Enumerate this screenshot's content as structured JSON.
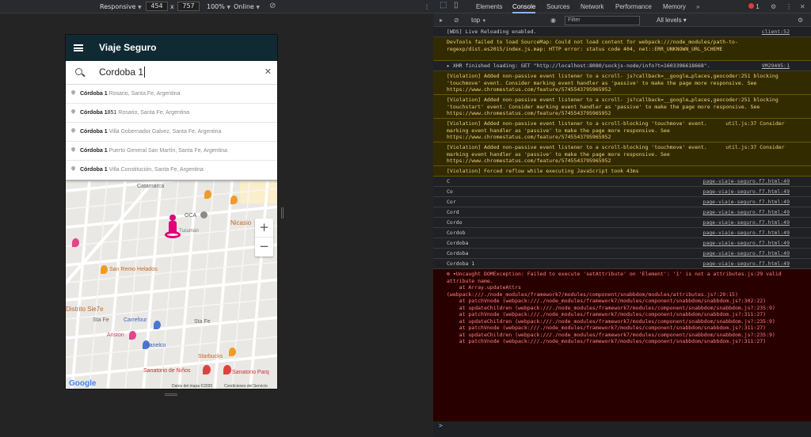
{
  "devbar": {
    "mode": "Responsive",
    "width": "454",
    "height": "757",
    "zoom": "100%",
    "network": "Online"
  },
  "app": {
    "title": "Viaje Seguro",
    "search_value": "Cordoba 1",
    "clear": "✕"
  },
  "suggestions": [
    {
      "bold": "Córdoba 1",
      "sec": " Rosario, Santa Fe, Argentina"
    },
    {
      "bold": "Córdoba 1",
      "mid": "851",
      "sec": " Rosario, Santa Fe, Argentina"
    },
    {
      "bold": "Córdoba 1",
      "sec": " Villa Gobernador Galvez, Santa Fe, Argentina"
    },
    {
      "bold": "Córdoba 1",
      "sec": " Puerto General San Martín, Santa Fe, Argentina"
    },
    {
      "bold": "Córdoba 1",
      "sec": " Villa Constitución, Santa Fe, Argentina"
    }
  ],
  "map": {
    "labels": [
      "Catamarca",
      "OCA",
      "Nicasio",
      "Tucumán",
      "San Remo Helados",
      "Distrito Sie7e",
      "Sta Fe",
      "Carrefour",
      "Sta Fe",
      "Ariston",
      "Banelco",
      "Starbucks",
      "Sanatorio de Niños",
      "Sanatorio Parq",
      "Google",
      "Datos del mapa ©2020",
      "Condiciones del Servicio"
    ],
    "zoom_in": "+",
    "zoom_out": "−"
  },
  "devtools": {
    "tabs": [
      "Elements",
      "Console",
      "Sources",
      "Network",
      "Performance",
      "Memory"
    ],
    "error_count": "1",
    "context": "top",
    "filter_placeholder": "Filter",
    "levels": "All levels ▾"
  },
  "console": [
    {
      "type": "log",
      "text": "[WDS] Live Reloading enabled.",
      "src": "client:52"
    },
    {
      "type": "warn",
      "text": "DevTools failed to load SourceMap: Could not load content for webpack:///node_modules/path-to-regexp/dist.es2015/index.js.map: HTTP error: status code 404, net::ERR_UNKNOWN_URL_SCHEME",
      "src": ""
    },
    {
      "type": "log",
      "text": "▸ XHR finished loading: GET \"http://localhost:8080/sockjs-node/info?t=1603396618668\".",
      "src": "VM29405:1"
    },
    {
      "type": "warn",
      "text": "[Violation] Added non-passive event listener to a scroll- js?callback=__google…places,geocoder:251 blocking 'touchmove' event. Consider marking event handler as 'passive' to make the page more responsive. See https://www.chromestatus.com/feature/5745543795965952",
      "src": ""
    },
    {
      "type": "warn",
      "text": "[Violation] Added non-passive event listener to a scroll- js?callback=__google…places,geocoder:251 blocking 'touchstart' event. Consider marking event handler as 'passive' to make the page more responsive. See https://www.chromestatus.com/feature/5745543795965952",
      "src": ""
    },
    {
      "type": "warn",
      "text": "[Violation] Added non-passive event listener to a scroll-blocking 'touchmove' event.      util.js:37 Consider marking event handler as 'passive' to make the page more responsive. See https://www.chromestatus.com/feature/5745543795965952",
      "src": ""
    },
    {
      "type": "warn",
      "text": "[Violation] Added non-passive event listener to a scroll-blocking 'touchmove' event.      util.js:37 Consider marking event handler as 'passive' to make the page more responsive. See https://www.chromestatus.com/feature/5745543795965952",
      "src": ""
    },
    {
      "type": "warn",
      "text": "[Violation] Forced reflow while executing JavaScript took 43ms",
      "src": ""
    },
    {
      "type": "log",
      "text": "C",
      "src": "page-viaje-seguro.f7.html:49"
    },
    {
      "type": "log",
      "text": "Co",
      "src": "page-viaje-seguro.f7.html:49"
    },
    {
      "type": "log",
      "text": "Cor",
      "src": "page-viaje-seguro.f7.html:49"
    },
    {
      "type": "log",
      "text": "Cord",
      "src": "page-viaje-seguro.f7.html:49"
    },
    {
      "type": "log",
      "text": "Cordo",
      "src": "page-viaje-seguro.f7.html:49"
    },
    {
      "type": "log",
      "text": "Cordob",
      "src": "page-viaje-seguro.f7.html:49"
    },
    {
      "type": "log",
      "text": "Cordoba",
      "src": "page-viaje-seguro.f7.html:49"
    },
    {
      "type": "log",
      "text": "Cordoba",
      "src": "page-viaje-seguro.f7.html:49"
    },
    {
      "type": "log",
      "text": "Cordoba 1",
      "src": "page-viaje-seguro.f7.html:49"
    },
    {
      "type": "err",
      "text": "⊗ ▾Uncaught DOMException: Failed to execute 'setAttribute' on 'Element': '1' is not a attributes.js:29 valid attribute name.\n    at Array.updateAttrs (webpack:///./node_modules/framework7/modules/component/snabbdom/modules/attributes.js?:29:15)\n    at patchVnode (webpack:///./node_modules/framework7/modules/component/snabbdom/snabbdom.js?:302:22)\n    at updateChildren (webpack:///./node_modules/framework7/modules/component/snabbdom/snabbdom.js?:235:9)\n    at patchVnode (webpack:///./node_modules/framework7/modules/component/snabbdom/snabbdom.js?:311:27)\n    at updateChildren (webpack:///./node_modules/framework7/modules/component/snabbdom/snabbdom.js?:235:9)\n    at patchVnode (webpack:///./node_modules/framework7/modules/component/snabbdom/snabbdom.js?:311:27)\n    at updateChildren (webpack:///./node_modules/framework7/modules/component/snabbdom/snabbdom.js?:235:9)\n    at patchVnode (webpack:///./node_modules/framework7/modules/component/snabbdom/snabbdom.js?:311:27)",
      "src": ""
    }
  ]
}
